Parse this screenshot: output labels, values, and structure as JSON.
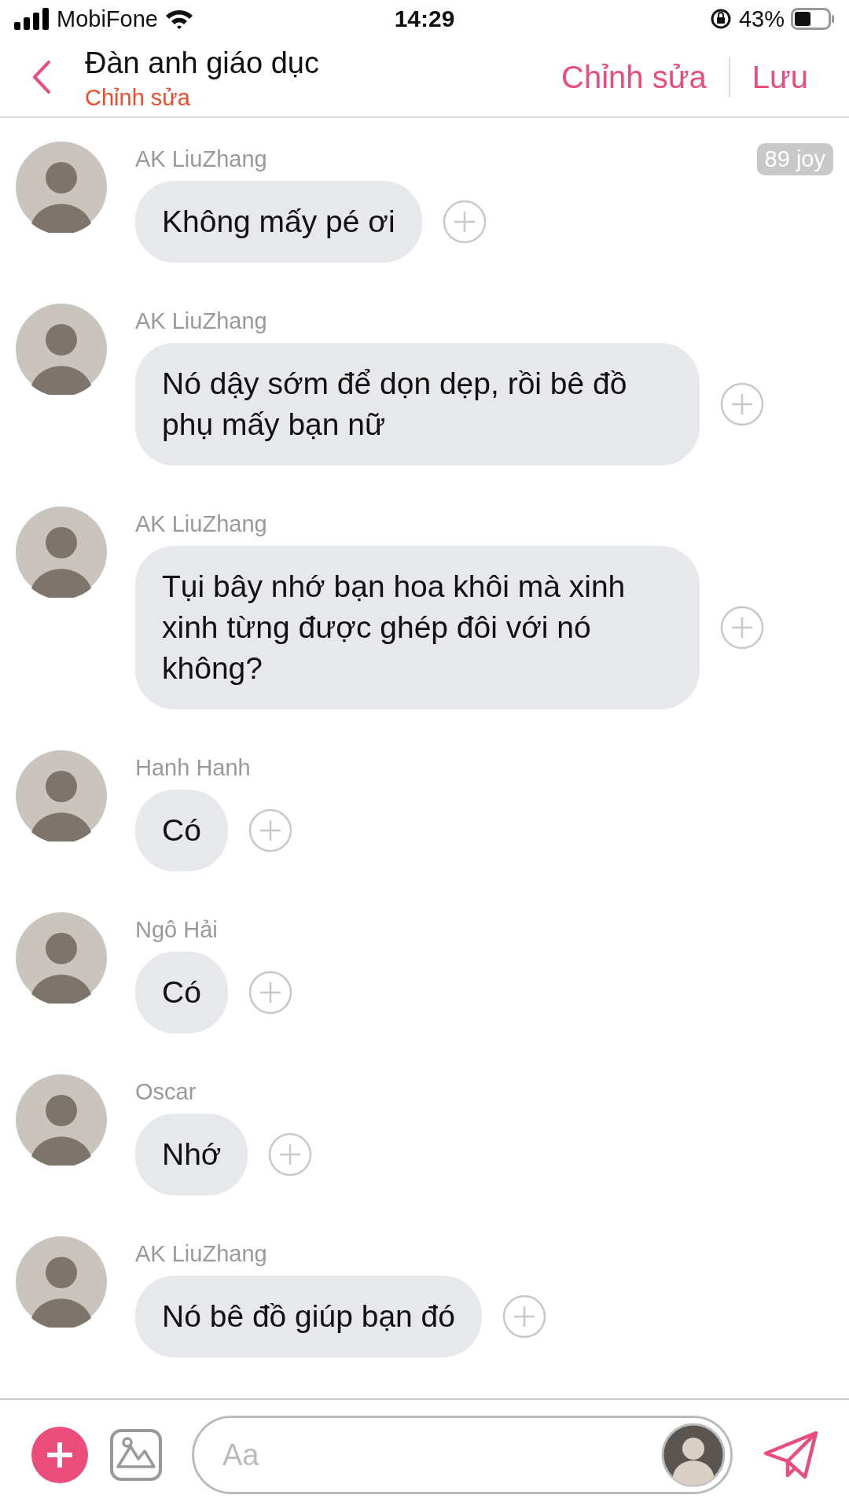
{
  "status_bar": {
    "carrier": "MobiFone",
    "time": "14:29",
    "battery": "43%"
  },
  "header": {
    "title": "Đàn anh giáo dục",
    "subtitle": "Chỉnh sửa",
    "actions": [
      "Chỉnh sửa",
      "Lưu"
    ]
  },
  "messages": [
    {
      "sender": "AK LiuZhang",
      "text": "Không mấy pé ơi",
      "badge": "89 joy"
    },
    {
      "sender": "AK LiuZhang",
      "text": "Nó dậy sớm để dọn dẹp, rồi bê đồ phụ mấy bạn nữ"
    },
    {
      "sender": "AK LiuZhang",
      "text": "Tụi bây nhớ bạn hoa khôi mà xinh xinh từng được ghép đôi với nó không?"
    },
    {
      "sender": "Hanh Hanh",
      "text": "Có"
    },
    {
      "sender": "Ngô Hải",
      "text": "Có"
    },
    {
      "sender": "Oscar",
      "text": "Nhớ"
    },
    {
      "sender": "AK LiuZhang",
      "text": "Nó bê đồ giúp bạn đó"
    }
  ],
  "composer": {
    "placeholder": "Aa"
  }
}
